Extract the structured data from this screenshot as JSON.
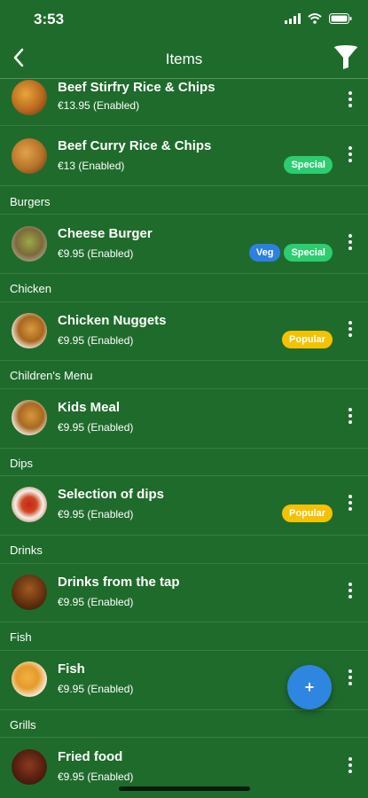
{
  "status": {
    "time": "3:53"
  },
  "nav": {
    "title": "Items"
  },
  "sections": {
    "burgers": "Burgers",
    "chicken": "Chicken",
    "childrens_menu": "Children's Menu",
    "dips": "Dips",
    "drinks": "Drinks",
    "fish": "Fish",
    "grills": "Grills"
  },
  "items": [
    {
      "name": "Beef Stirfry Rice & Chips",
      "price": "€13.95 (Enabled)",
      "badges": []
    },
    {
      "name": "Beef Curry Rice & Chips",
      "price": "€13 (Enabled)",
      "badges": [
        "Special"
      ]
    },
    {
      "name": "Cheese Burger",
      "price": "€9.95 (Enabled)",
      "badges": [
        "Veg",
        "Special"
      ]
    },
    {
      "name": "Chicken Nuggets",
      "price": "€9.95 (Enabled)",
      "badges": [
        "Popular"
      ]
    },
    {
      "name": "Kids Meal",
      "price": "€9.95 (Enabled)",
      "badges": []
    },
    {
      "name": "Selection of dips",
      "price": "€9.95 (Enabled)",
      "badges": [
        "Popular"
      ]
    },
    {
      "name": "Drinks from the tap",
      "price": "€9.95 (Enabled)",
      "badges": []
    },
    {
      "name": "Fish",
      "price": "€9.95 (Enabled)",
      "badges": []
    },
    {
      "name": "Fried food",
      "price": "€9.95 (Enabled)",
      "badges": []
    }
  ],
  "fab": {
    "label": "+"
  },
  "colors": {
    "background": "#1f6b2c",
    "special": "#2ecc71",
    "veg": "#2f7fe0",
    "popular": "#f4c200",
    "fab": "#2f86e0"
  }
}
